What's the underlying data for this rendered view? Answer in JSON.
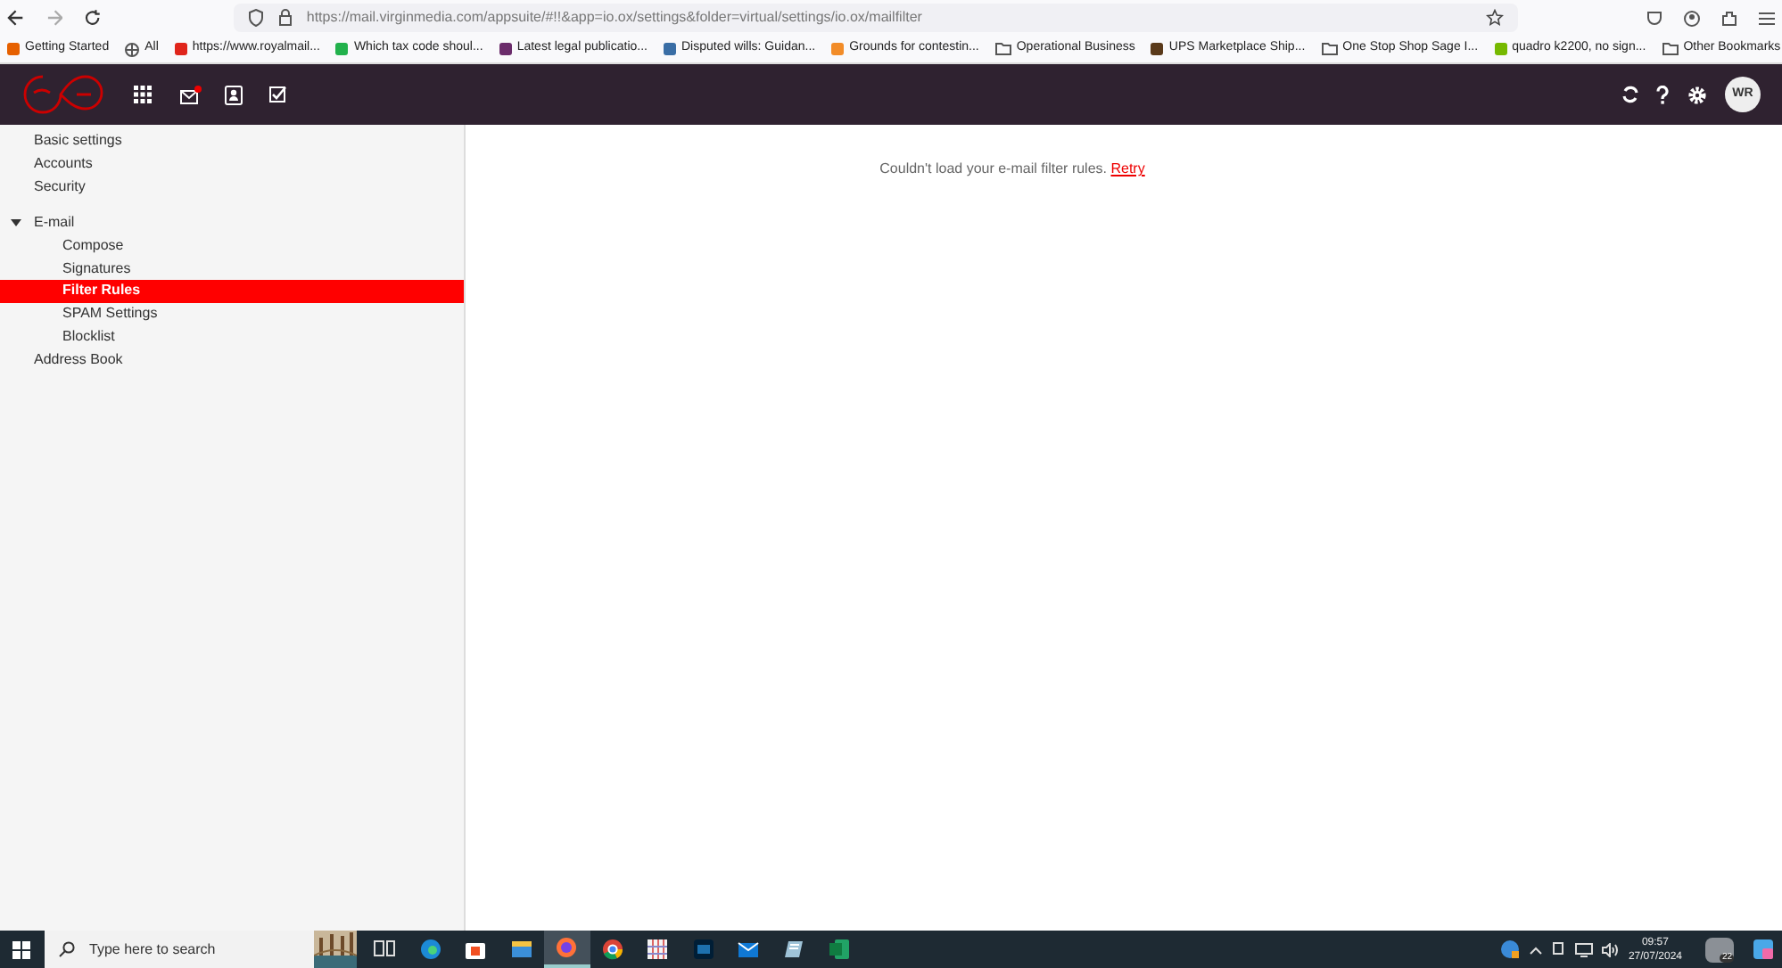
{
  "browser": {
    "url": "https://mail.virginmedia.com/appsuite/#!!&app=io.ox/settings&folder=virtual/settings/io.ox/mailfilter",
    "bookmarks": [
      {
        "label": "Getting Started",
        "kind": "site",
        "color": "#e66000"
      },
      {
        "label": "All",
        "kind": "globe"
      },
      {
        "label": "https://www.royalmail...",
        "kind": "site",
        "color": "#e0251b"
      },
      {
        "label": "Which tax code shoul...",
        "kind": "site",
        "color": "#22b14c"
      },
      {
        "label": "Latest legal publicatio...",
        "kind": "site",
        "color": "#6b2c6b"
      },
      {
        "label": "Disputed wills: Guidan...",
        "kind": "site",
        "color": "#3a6ea5"
      },
      {
        "label": "Grounds for contestin...",
        "kind": "site",
        "color": "#f28c28"
      },
      {
        "label": "Operational Business",
        "kind": "folder"
      },
      {
        "label": "UPS Marketplace Ship...",
        "kind": "site",
        "color": "#5a3a1a"
      },
      {
        "label": "One Stop Shop Sage I...",
        "kind": "folder"
      },
      {
        "label": "quadro k2200, no sign...",
        "kind": "site",
        "color": "#76b900"
      }
    ],
    "other_bookmarks": "Other Bookmarks"
  },
  "header": {
    "avatar": "WR",
    "mail_unread": true
  },
  "sidebar": {
    "items": [
      {
        "label": "Basic settings",
        "selected": false
      },
      {
        "label": "Accounts",
        "selected": false
      },
      {
        "label": "Security",
        "selected": false
      },
      {
        "label": "E-mail",
        "selected": false,
        "expanded": true,
        "children": [
          {
            "label": "Compose",
            "selected": false
          },
          {
            "label": "Signatures",
            "selected": false
          },
          {
            "label": "Filter Rules",
            "selected": true
          },
          {
            "label": "SPAM Settings",
            "selected": false
          },
          {
            "label": "Blocklist",
            "selected": false
          }
        ]
      },
      {
        "label": "Address Book",
        "selected": false
      }
    ]
  },
  "content": {
    "message": "Couldn't load your e-mail filter rules.",
    "link": "Retry"
  },
  "taskbar": {
    "search_placeholder": "Type here to search",
    "apps": [
      {
        "kind": "taskview",
        "selected": false
      },
      {
        "kind": "edge",
        "selected": false
      },
      {
        "kind": "store",
        "selected": false
      },
      {
        "kind": "files",
        "selected": false
      },
      {
        "kind": "firefox",
        "selected": true
      },
      {
        "kind": "chrome",
        "selected": false
      },
      {
        "kind": "grid",
        "selected": false
      },
      {
        "kind": "photoshop",
        "selected": false
      },
      {
        "kind": "mail",
        "selected": false
      },
      {
        "kind": "notes",
        "selected": false
      },
      {
        "kind": "excel",
        "selected": false
      }
    ],
    "time": "09:57",
    "date": "27/07/2024",
    "notifications": "22"
  }
}
